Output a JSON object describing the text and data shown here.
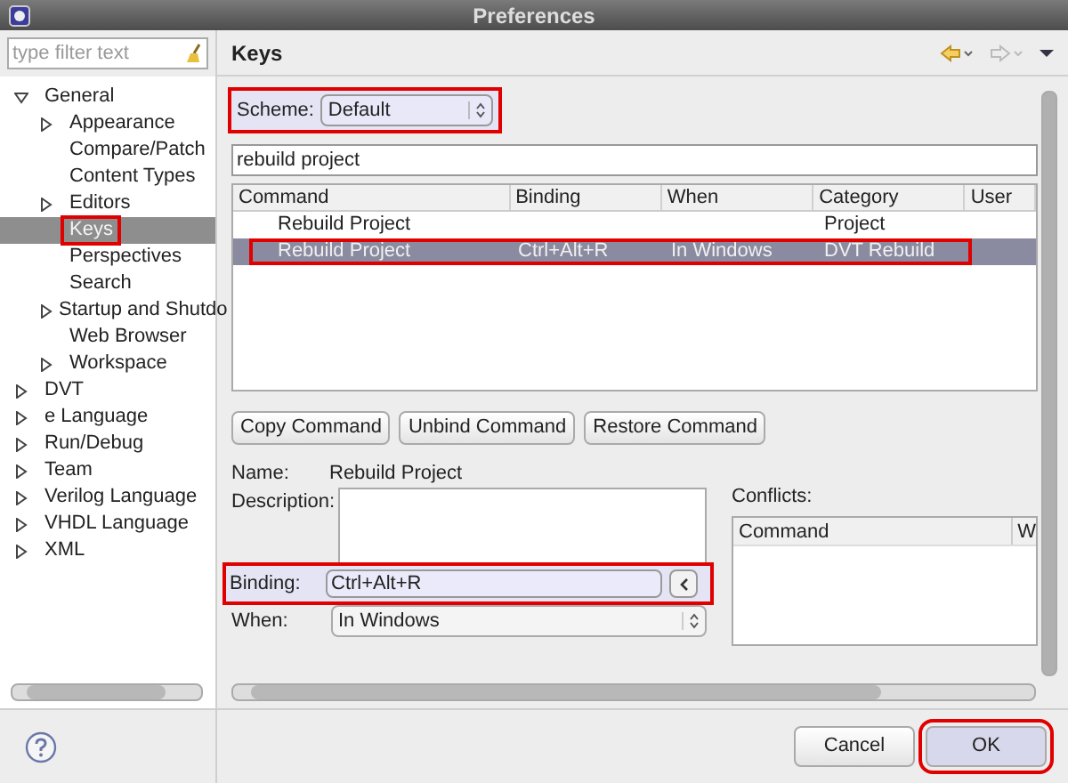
{
  "window": {
    "title": "Preferences"
  },
  "filter": {
    "placeholder": "type filter text"
  },
  "tree": [
    {
      "label": "General",
      "expanded": true,
      "selected": false,
      "highlighted": false,
      "children": [
        {
          "label": "Appearance",
          "expanded": false,
          "has_children": true,
          "selected": false,
          "highlighted": false
        },
        {
          "label": "Compare/Patch",
          "has_children": false,
          "selected": false,
          "highlighted": false
        },
        {
          "label": "Content Types",
          "has_children": false,
          "selected": false,
          "highlighted": false
        },
        {
          "label": "Editors",
          "expanded": false,
          "has_children": true,
          "selected": false,
          "highlighted": false
        },
        {
          "label": "Keys",
          "has_children": false,
          "selected": true,
          "highlighted": true
        },
        {
          "label": "Perspectives",
          "has_children": false,
          "selected": false,
          "highlighted": false
        },
        {
          "label": "Search",
          "has_children": false,
          "selected": false,
          "highlighted": false
        },
        {
          "label": "Startup and Shutdo",
          "expanded": false,
          "has_children": true,
          "selected": false,
          "highlighted": false
        },
        {
          "label": "Web Browser",
          "has_children": false,
          "selected": false,
          "highlighted": false
        },
        {
          "label": "Workspace",
          "expanded": false,
          "has_children": true,
          "selected": false,
          "highlighted": false
        }
      ]
    },
    {
      "label": "DVT",
      "expanded": false,
      "has_children": true,
      "selected": false,
      "highlighted": false
    },
    {
      "label": "e Language",
      "expanded": false,
      "has_children": true,
      "selected": false,
      "highlighted": false
    },
    {
      "label": "Run/Debug",
      "expanded": false,
      "has_children": true,
      "selected": false,
      "highlighted": false
    },
    {
      "label": "Team",
      "expanded": false,
      "has_children": true,
      "selected": false,
      "highlighted": false
    },
    {
      "label": "Verilog Language",
      "expanded": false,
      "has_children": true,
      "selected": false,
      "highlighted": false
    },
    {
      "label": "VHDL Language",
      "expanded": false,
      "has_children": true,
      "selected": false,
      "highlighted": false
    },
    {
      "label": "XML",
      "expanded": false,
      "has_children": true,
      "selected": false,
      "highlighted": false
    }
  ],
  "page": {
    "title": "Keys",
    "scheme": {
      "label": "Scheme:",
      "value": "Default",
      "highlighted": true
    },
    "search": {
      "value": "rebuild project"
    },
    "table": {
      "columns": [
        "Command",
        "Binding",
        "When",
        "Category",
        "User"
      ],
      "rows": [
        {
          "cells": [
            "Rebuild Project",
            "",
            "",
            "Project",
            ""
          ],
          "selected": false,
          "highlighted": false
        },
        {
          "cells": [
            "Rebuild Project",
            "Ctrl+Alt+R",
            "In Windows",
            "DVT Rebuild",
            ""
          ],
          "selected": true,
          "highlighted": true
        }
      ]
    },
    "buttons": [
      "Copy Command",
      "Unbind Command",
      "Restore Command"
    ],
    "name": {
      "label": "Name:",
      "value": "Rebuild Project"
    },
    "description": {
      "label": "Description:"
    },
    "binding": {
      "label": "Binding:",
      "value": "Ctrl+Alt+R",
      "highlighted": true
    },
    "when": {
      "label": "When:",
      "value": "In Windows"
    },
    "conflicts": {
      "label": "Conflicts:",
      "columns": [
        "Command",
        "W"
      ]
    }
  },
  "footer": {
    "buttons": [
      {
        "label": "Cancel",
        "highlighted": false
      },
      {
        "label": "OK",
        "highlighted": true
      }
    ]
  }
}
